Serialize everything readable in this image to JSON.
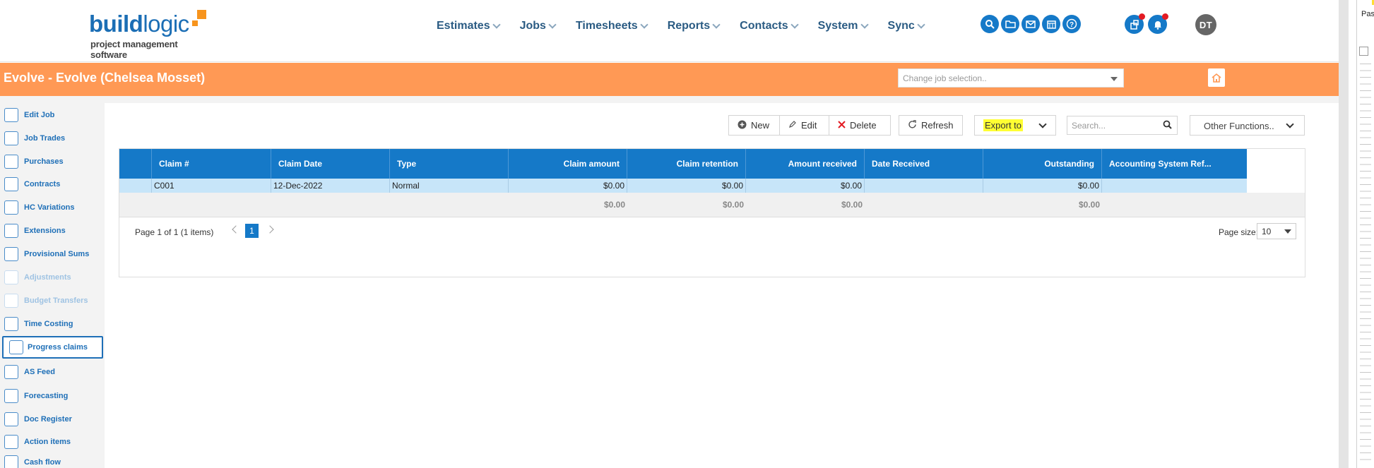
{
  "header": {
    "logo_word_bold": "build",
    "logo_word_light": "logic",
    "logo_tagline": "project management software",
    "nav": [
      {
        "label": "Estimates"
      },
      {
        "label": "Jobs"
      },
      {
        "label": "Timesheets"
      },
      {
        "label": "Reports"
      },
      {
        "label": "Contacts"
      },
      {
        "label": "System"
      },
      {
        "label": "Sync"
      }
    ],
    "tool_icons": [
      "search-icon",
      "folder-icon",
      "mail-icon",
      "calendar-icon",
      "help-icon"
    ],
    "notif_icons": [
      "tasks-icon",
      "bell-icon"
    ],
    "avatar_initials": "DT"
  },
  "jobbar": {
    "title": "Evolve - Evolve (Chelsea Mosset)",
    "job_select_placeholder": "Change job selection..",
    "color": "#ff9955"
  },
  "sidebar": {
    "items": [
      {
        "label": "Edit Job",
        "icon": "pencil-icon",
        "disabled": false
      },
      {
        "label": "Job Trades",
        "icon": "folder-icon",
        "disabled": false
      },
      {
        "label": "Purchases",
        "icon": "coins-icon",
        "disabled": false
      },
      {
        "label": "Contracts",
        "icon": "contract-icon",
        "disabled": false
      },
      {
        "label": "HC Variations",
        "icon": "hc-variations-icon",
        "disabled": false
      },
      {
        "label": "Extensions",
        "icon": "clock-icon",
        "disabled": false
      },
      {
        "label": "Provisional Sums",
        "icon": "dollar-icon",
        "disabled": false
      },
      {
        "label": "Adjustments",
        "icon": "adjust-icon",
        "disabled": true
      },
      {
        "label": "Budget Transfers",
        "icon": "transfer-icon",
        "disabled": true
      },
      {
        "label": "Time Costing",
        "icon": "time-costing-icon",
        "disabled": false
      },
      {
        "label": "Progress claims",
        "icon": "progress-claims-icon",
        "disabled": false,
        "active": true
      },
      {
        "label": "AS Feed",
        "icon": "feed-icon",
        "disabled": false
      },
      {
        "label": "Forecasting",
        "icon": "chart-icon",
        "disabled": false
      },
      {
        "label": "Doc Register",
        "icon": "doc-icon",
        "disabled": false
      },
      {
        "label": "Action items",
        "icon": "action-icon",
        "disabled": false
      },
      {
        "label": "Cash flow",
        "icon": "cashflow-icon",
        "disabled": false
      }
    ]
  },
  "toolbar": {
    "new_label": "New",
    "edit_label": "Edit",
    "delete_label": "Delete",
    "refresh_label": "Refresh",
    "export_label": "Export to",
    "search_placeholder": "Search...",
    "other_functions_label": "Other Functions..",
    "highlight_color": "#ffff33"
  },
  "grid": {
    "columns": [
      "Claim #",
      "Claim Date",
      "Type",
      "Claim amount",
      "Claim retention",
      "Amount received",
      "Date Received",
      "Outstanding",
      "Accounting System Ref..."
    ],
    "rows": [
      {
        "claim_no": "C001",
        "claim_date": "12-Dec-2022",
        "type": "Normal",
        "claim_amount": "$0.00",
        "claim_retention": "$0.00",
        "amount_received": "$0.00",
        "date_received": "",
        "outstanding": "$0.00",
        "acct_ref": ""
      }
    ],
    "totals": {
      "claim_amount": "$0.00",
      "claim_retention": "$0.00",
      "amount_received": "$0.00",
      "outstanding": "$0.00"
    },
    "header_color": "#1579c8",
    "row_color": "#c7e5f9"
  },
  "pager": {
    "info": "Page 1 of 1 (1 items)",
    "current_page": "1",
    "page_size_label": "Page size:",
    "page_size": "10"
  },
  "ruler": {
    "label": "Pas"
  }
}
